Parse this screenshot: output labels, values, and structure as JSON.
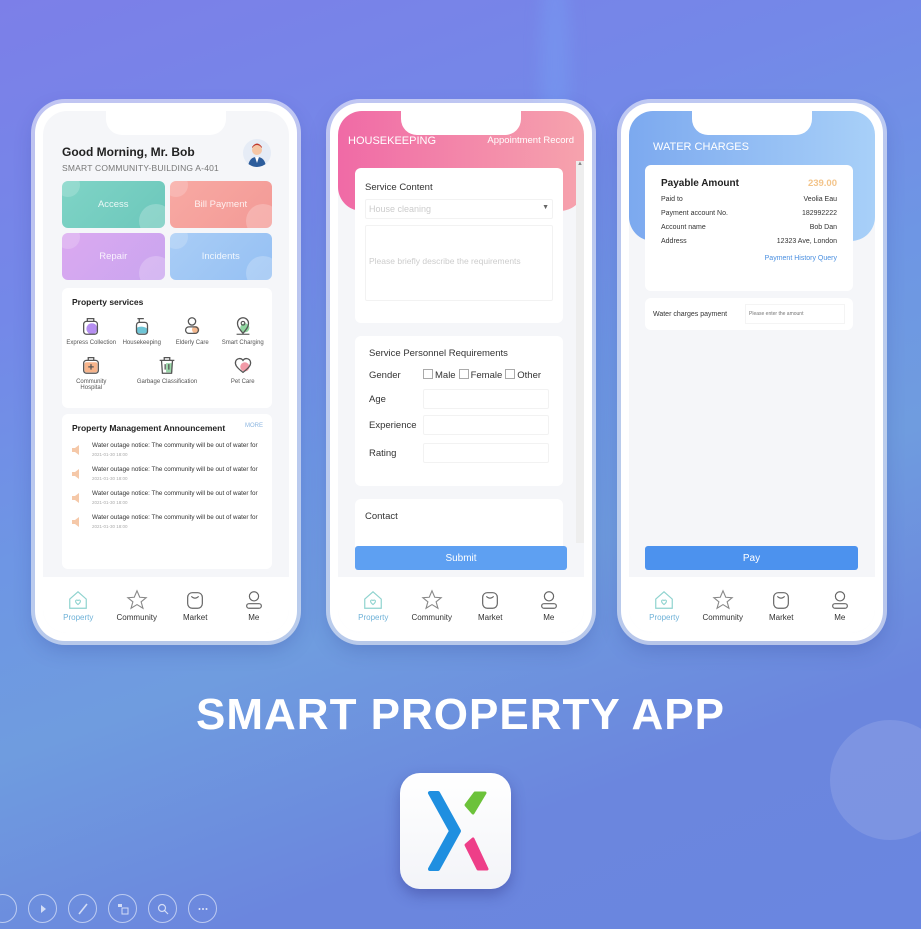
{
  "headline": "SMART PROPERTY APP",
  "tabbar": [
    {
      "label": "Property",
      "icon": "home-icon",
      "active": true
    },
    {
      "label": "Community",
      "icon": "star-icon"
    },
    {
      "label": "Market",
      "icon": "shopping-bag-icon"
    },
    {
      "label": "Me",
      "icon": "user-icon"
    }
  ],
  "home": {
    "greeting": "Good Morning, Mr. Bob",
    "address": "SMART COMMUNITY-BUILDING A-401",
    "tiles": [
      {
        "label": "Access",
        "color": "#7fd0c4"
      },
      {
        "label": "Bill Payment",
        "color": "#f5a39f"
      },
      {
        "label": "Repair",
        "color": "#d6a6ee"
      },
      {
        "label": "Incidents",
        "color": "#9fc6f4"
      }
    ],
    "services_title": "Property services",
    "services": [
      {
        "label": "Express Collection",
        "icon": "package-icon"
      },
      {
        "label": "Housekeeping",
        "icon": "spray-bottle-icon"
      },
      {
        "label": "Elderly Care",
        "icon": "person-icon"
      },
      {
        "label": "Smart Charging",
        "icon": "location-pin-icon"
      },
      {
        "label": "Community Hospital",
        "icon": "medical-kit-icon"
      },
      {
        "label": "Garbage Classification",
        "icon": "trash-icon"
      },
      {
        "label": "Pet Care",
        "icon": "heart-icon"
      }
    ],
    "announcement_title": "Property Management Announcement",
    "more_label": "MORE",
    "announcements": [
      {
        "text": "Water outage notice: The community will be out of water for",
        "time": "2021-01-30 18:00"
      },
      {
        "text": "Water outage notice: The community will be out of water for",
        "time": "2021-01-30 18:00"
      },
      {
        "text": "Water outage notice: The community will be out of water for",
        "time": "2021-01-30 18:00"
      },
      {
        "text": "Water outage notice: The community will be out of water for",
        "time": "2021-01-30 18:00"
      }
    ]
  },
  "housekeeping": {
    "title": "HOUSEKEEPING",
    "record_link": "Appointment Record",
    "service_content_label": "Service Content",
    "service_select_value": "House cleaning",
    "description_placeholder": "Please briefly describe the requirements",
    "personnel_title": "Service Personnel Requirements",
    "gender_label": "Gender",
    "gender_options": [
      "Male",
      "Female",
      "Other"
    ],
    "age_label": "Age",
    "experience_label": "Experience",
    "rating_label": "Rating",
    "contact_label": "Contact",
    "submit_label": "Submit"
  },
  "water": {
    "title": "WATER CHARGES",
    "payable_label": "Payable Amount",
    "payable_value": "239.00",
    "rows": [
      {
        "label": "Paid to",
        "value": "Veolia Eau"
      },
      {
        "label": "Payment account No.",
        "value": "182992222"
      },
      {
        "label": "Account name",
        "value": "Bob Dan"
      },
      {
        "label": "Address",
        "value": "12323 Ave, London"
      }
    ],
    "history_link": "Payment History Query",
    "payment_label": "Water charges payment",
    "amount_placeholder": "Please enter the amount",
    "pay_label": "Pay"
  },
  "controls": [
    "play-icon",
    "pen-icon",
    "slides-icon",
    "zoom-icon",
    "more-icon"
  ]
}
